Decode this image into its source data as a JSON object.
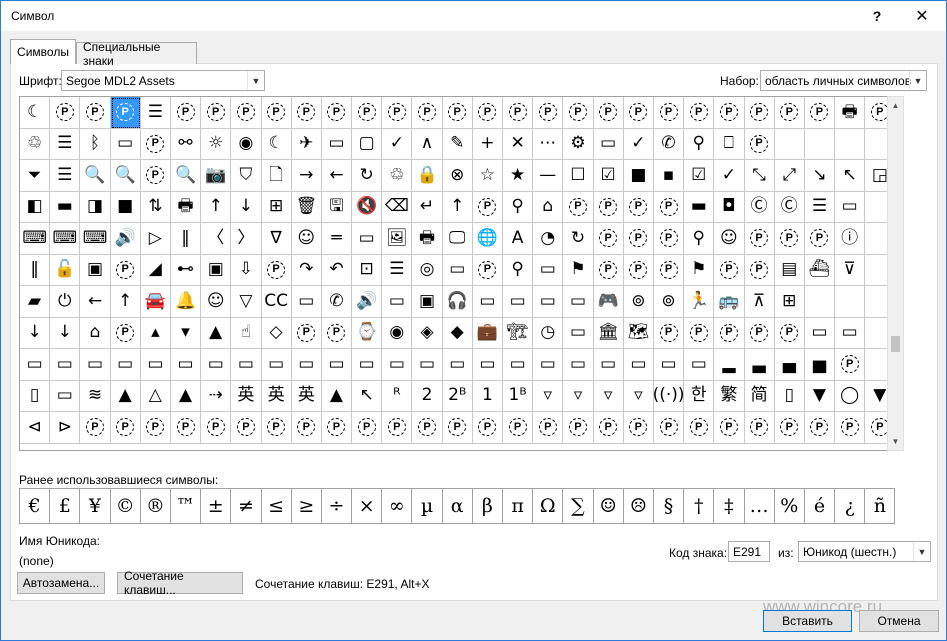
{
  "window": {
    "title": "Символ",
    "help": "?",
    "close": "✕"
  },
  "tabs": [
    {
      "label": "Символы"
    },
    {
      "label": "Специальные знаки"
    }
  ],
  "font": {
    "label": "Шрифт:",
    "value": "Segoe MDL2 Assets"
  },
  "subset": {
    "label": "Набор:",
    "value": "область личных символов"
  },
  "grid": {
    "selected_index": 3,
    "cells": [
      "☾",
      "ⓟ",
      "ⓟ",
      "ⓟ",
      "☰",
      "ⓟ",
      "ⓟ",
      "ⓟ",
      "ⓟ",
      "ⓟ",
      "ⓟ",
      "ⓟ",
      "ⓟ",
      "ⓟ",
      "ⓟ",
      "ⓟ",
      "ⓟ",
      "ⓟ",
      "ⓟ",
      "ⓟ",
      "ⓟ",
      "ⓟ",
      "ⓟ",
      "ⓟ",
      "ⓟ",
      "ⓟ",
      "ⓟ",
      "🖶",
      "ⓟ",
      "♲",
      "☰",
      "ᛒ",
      "▭",
      "ⓟ",
      "⚯",
      "☼",
      "◉",
      "☾",
      "✈",
      "▭",
      "▢",
      "✓",
      "∧",
      "✎",
      "+",
      "✕",
      "⋯",
      "⚙",
      "▭",
      "✓",
      "✆",
      "⚲",
      "⎕",
      "ⓟ",
      "",
      "",
      "",
      "",
      "⏷",
      "☰",
      "🔍",
      "🔍",
      "ⓟ",
      "🔍",
      "📷",
      "⛉",
      "🗋",
      "→",
      "←",
      "↻",
      "♲",
      "🔒",
      "⊗",
      "☆",
      "★",
      "—",
      "☐",
      "☑",
      "■",
      "▪",
      "☑",
      "✓",
      "⤡",
      "⤢",
      "↘",
      "↖",
      "◲",
      "◧",
      "▬",
      "◨",
      "■",
      "⇅",
      "🖶",
      "↑",
      "↓",
      "⊞",
      "🗑",
      "🖫",
      "🔇",
      "⌫",
      "↵",
      "↑",
      "ⓟ",
      "⚲",
      "⌂",
      "ⓟ",
      "ⓟ",
      "ⓟ",
      "ⓟ",
      "▬",
      "◘",
      "Ⓒ",
      "Ⓒ",
      "☰",
      "▭",
      "",
      "⌨",
      "⌨",
      "⌨",
      "🔊",
      "▷",
      "‖",
      "〈",
      "〉",
      "∇",
      "☺",
      "═",
      "▭",
      "🖼",
      "🖶",
      "🖵",
      "🌐",
      "A",
      "◔",
      "↻",
      "ⓟ",
      "ⓟ",
      "ⓟ",
      "⚲",
      "☺",
      "ⓟ",
      "ⓟ",
      "ⓟ",
      "ⓘ",
      "",
      "‖",
      "🔓",
      "▣",
      "ⓟ",
      "◢",
      "⊷",
      "▣",
      "⇩",
      "ⓟ",
      "↷",
      "↶",
      "⊡",
      "☰",
      "◎",
      "▭",
      "ⓟ",
      "⚲",
      "▭",
      "⚑",
      "ⓟ",
      "ⓟ",
      "ⓟ",
      "⚑",
      "ⓟ",
      "ⓟ",
      "▤",
      "⛴",
      "⊽",
      "",
      "▰",
      "⏻",
      "←",
      "↑",
      "🚘",
      "🔔",
      "☺",
      "▽",
      "CC",
      "▭",
      "✆",
      "🔊",
      "▭",
      "▣",
      "🎧",
      "▭",
      "▭",
      "▭",
      "▭",
      "🎮",
      "⊚",
      "⊚",
      "🏃",
      "🚌",
      "⊼",
      "⊞",
      "",
      "",
      "",
      "↓",
      "↓",
      "⌂",
      "ⓟ",
      "▴",
      "▾",
      "▲",
      "☝",
      "◇",
      "ⓟ",
      "ⓟ",
      "⌚",
      "◉",
      "◈",
      "◆",
      "💼",
      "🏗",
      "◷",
      "▭",
      "🏛",
      "🗺",
      "ⓟ",
      "ⓟ",
      "ⓟ",
      "ⓟ",
      "ⓟ",
      "▭",
      "▭",
      "",
      "▭",
      "▭",
      "▭",
      "▭",
      "▭",
      "▭",
      "▭",
      "▭",
      "▭",
      "▭",
      "▭",
      "▭",
      "▭",
      "▭",
      "▭",
      "▭",
      "▭",
      "▭",
      "▭",
      "▭",
      "▭",
      "▭",
      "▭",
      "▂",
      "▃",
      "▄",
      "▅",
      "ⓟ",
      "",
      "▯",
      "▭",
      "≋",
      "▲",
      "△",
      "▲",
      "⇢",
      "英",
      "英",
      "英",
      "▲",
      "↖",
      "ᴿ",
      "2",
      "2ᴮ",
      "1",
      "1ᴮ",
      "▿",
      "▿",
      "▿",
      "▿",
      "((·))",
      "한",
      "繁",
      "简",
      "▯",
      "▼",
      "◯",
      "▼",
      "⊲",
      "⊳",
      "ⓟ",
      "ⓟ",
      "ⓟ",
      "ⓟ",
      "ⓟ",
      "ⓟ",
      "ⓟ",
      "ⓟ",
      "ⓟ",
      "ⓟ",
      "ⓟ",
      "ⓟ",
      "ⓟ",
      "ⓟ",
      "ⓟ",
      "ⓟ",
      "ⓟ",
      "ⓟ",
      "ⓟ",
      "ⓟ",
      "ⓟ",
      "ⓟ",
      "ⓟ",
      "ⓟ",
      "ⓟ",
      "ⓟ",
      "ⓟ"
    ]
  },
  "recent": {
    "label": "Ранее использовавшиеся символы:",
    "symbols": [
      "€",
      "£",
      "¥",
      "©",
      "®",
      "™",
      "±",
      "≠",
      "≤",
      "≥",
      "÷",
      "×",
      "∞",
      "µ",
      "α",
      "β",
      "π",
      "Ω",
      "∑",
      "☺",
      "☹",
      "§",
      "†",
      "‡",
      "…",
      "%",
      "é",
      "¿",
      "ñ"
    ]
  },
  "unicode_name": {
    "label": "Имя Юникода:",
    "value": "(none)"
  },
  "char_code": {
    "label": "Код знака:",
    "value": "E291"
  },
  "from": {
    "label": "из:",
    "value": "Юникод (шестн.)"
  },
  "buttons": {
    "autocorrect": "Автозамена...",
    "shortcut_key": "Сочетание клавиш...",
    "insert": "Вставить",
    "cancel": "Отмена"
  },
  "shortcut_text": "Сочетание клавиш: E291, Alt+X",
  "watermark": "www.wincore.ru",
  "colors": {
    "selection": "#3399ff",
    "accent_border": "#2b79d8"
  }
}
